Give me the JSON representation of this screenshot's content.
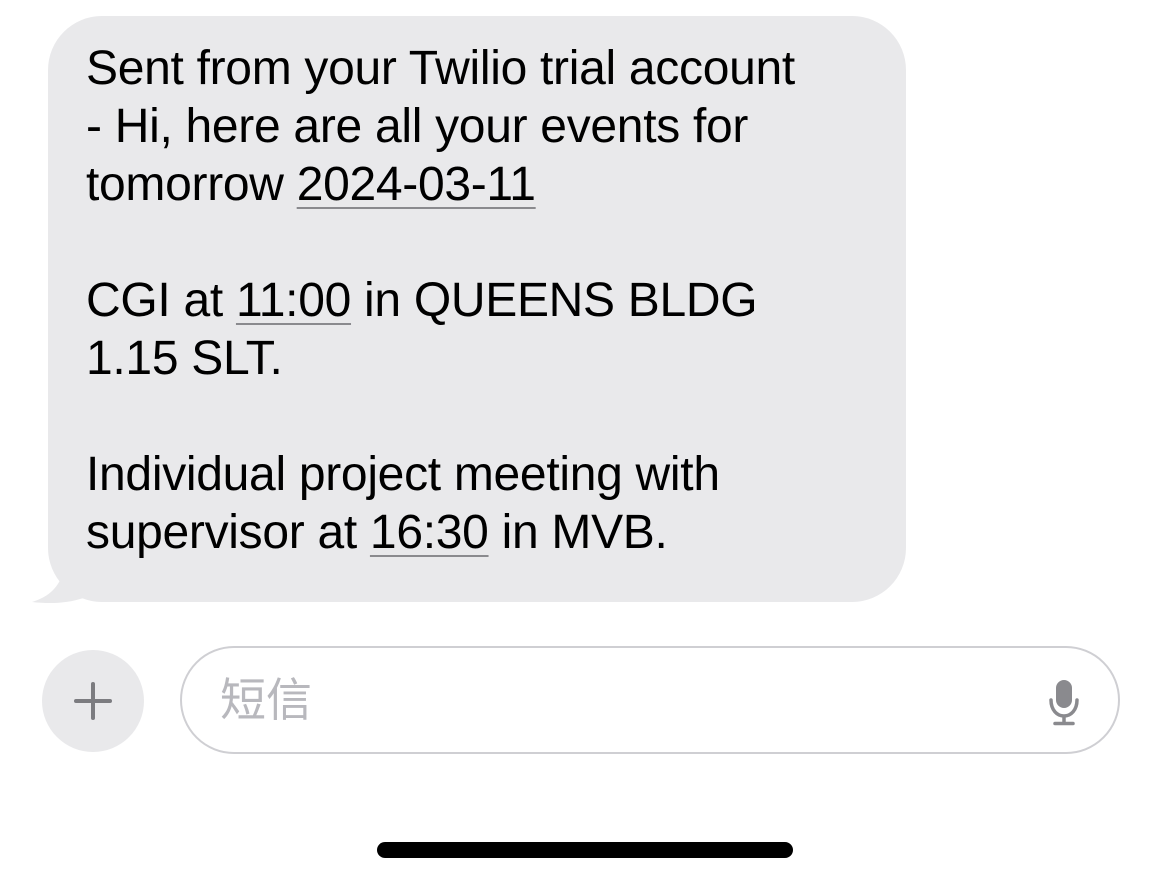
{
  "message": {
    "line1": "Sent from your Twilio trial account",
    "line2": "- Hi, here are all your events for",
    "line3_prefix": "tomorrow ",
    "date_link": "2024-03-11",
    "event1_prefix": "CGI at ",
    "event1_time": "11:00",
    "event1_suffix": " in QUEENS BLDG",
    "event1_line2": "1.15 SLT.",
    "event2_line1": "Individual project meeting with",
    "event2_prefix": "supervisor at ",
    "event2_time": "16:30",
    "event2_suffix": " in MVB."
  },
  "composer": {
    "placeholder": "短信",
    "plus_icon": "plus-icon",
    "mic_icon": "microphone-icon"
  },
  "colors": {
    "bubble_gray": "#e9e9eb",
    "link_underline": "#8a8a8e",
    "placeholder_gray": "#b8b8bd",
    "icon_gray": "#7c7c80"
  }
}
